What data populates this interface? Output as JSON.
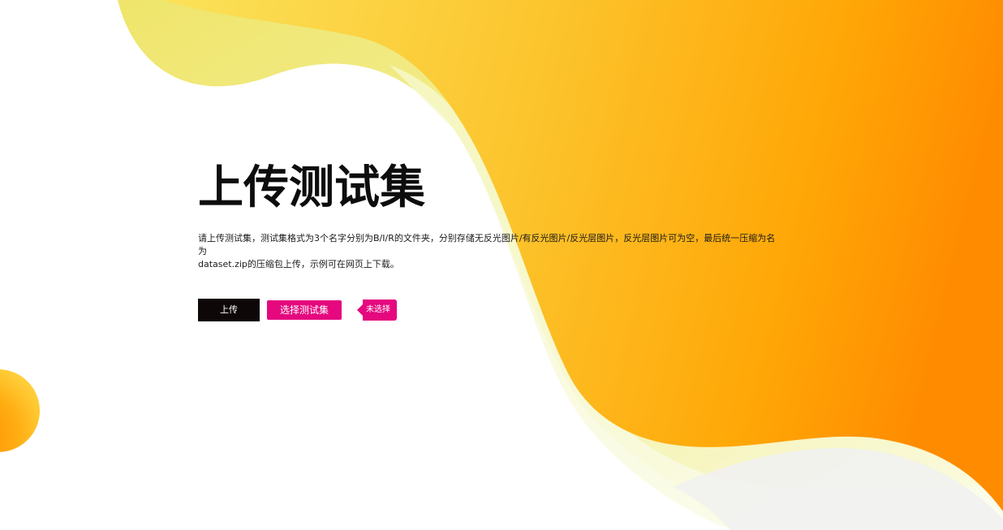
{
  "page": {
    "title": "上传测试集",
    "description_line1": "请上传测试集，测试集格式为3个名字分别为B/I/R的文件夹，分别存储无反光图片/有反光图片/反光层图片，反光层图片可为空，最后统一压缩为名为",
    "description_line2": "dataset.zip的压缩包上传，示例可在网页上下载。"
  },
  "actions": {
    "upload_label": "上传",
    "choose_label": "选择测试集",
    "file_status": "未选择"
  },
  "colors": {
    "accent_pink": "#e5087e",
    "button_dark": "#0d0707",
    "orange": "#ff8c00",
    "yellow": "#f5e66a"
  }
}
